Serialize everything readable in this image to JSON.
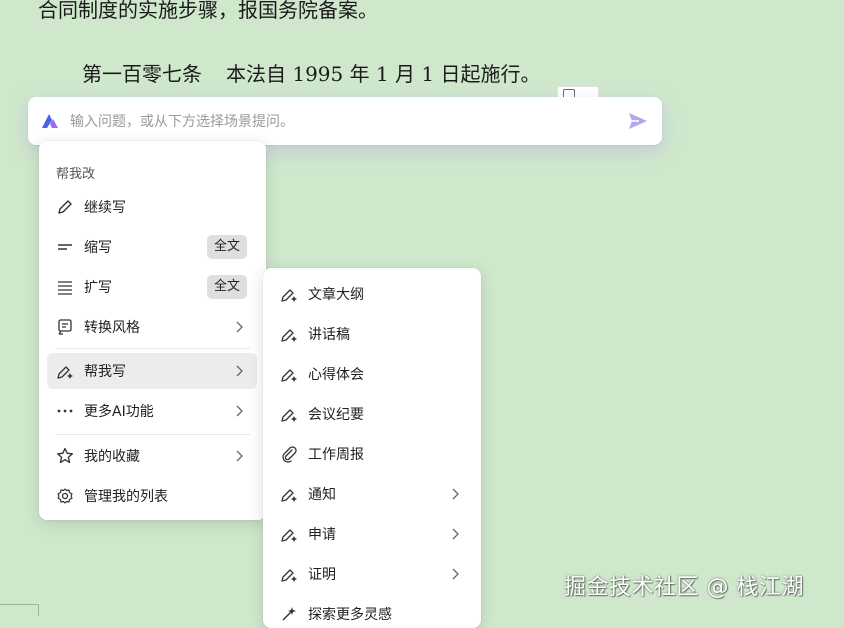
{
  "document": {
    "line_top": "合同制度的实施步骤，报国务院备案。",
    "article_number": "第一百零七条",
    "article_text": "本法自 1995 年 1 月 1 日起施行。"
  },
  "ask_bar": {
    "placeholder": "输入问题，或从下方选择场景提问。"
  },
  "main_menu": {
    "header": "帮我改",
    "items": [
      {
        "label": "继续写",
        "icon": "pencil-icon"
      },
      {
        "label": "缩写",
        "icon": "short-lines-icon",
        "badge": "全文"
      },
      {
        "label": "扩写",
        "icon": "long-lines-icon",
        "badge": "全文"
      },
      {
        "label": "转换风格",
        "icon": "style-icon"
      },
      {
        "label": "帮我写",
        "icon": "ai-pen-icon"
      },
      {
        "label": "更多AI功能",
        "icon": "more-icon"
      },
      {
        "label": "我的收藏",
        "icon": "star-icon"
      },
      {
        "label": "管理我的列表",
        "icon": "gear-icon"
      }
    ]
  },
  "sub_menu": {
    "items": [
      {
        "label": "文章大纲",
        "icon": "ai-pen-icon"
      },
      {
        "label": "讲话稿",
        "icon": "ai-pen-icon"
      },
      {
        "label": "心得体会",
        "icon": "ai-pen-icon"
      },
      {
        "label": "会议纪要",
        "icon": "ai-pen-icon"
      },
      {
        "label": "工作周报",
        "icon": "paperclip-icon"
      },
      {
        "label": "通知",
        "icon": "ai-pen-icon"
      },
      {
        "label": "申请",
        "icon": "ai-pen-icon"
      },
      {
        "label": "证明",
        "icon": "ai-pen-icon"
      },
      {
        "label": "探索更多灵感",
        "icon": "sparkle-icon"
      }
    ]
  },
  "watermark": "掘金技术社区 @ 栈江湖",
  "colors": {
    "background": "#cfe8cc",
    "accent": "#a98bf0",
    "hover": "#ececec"
  }
}
